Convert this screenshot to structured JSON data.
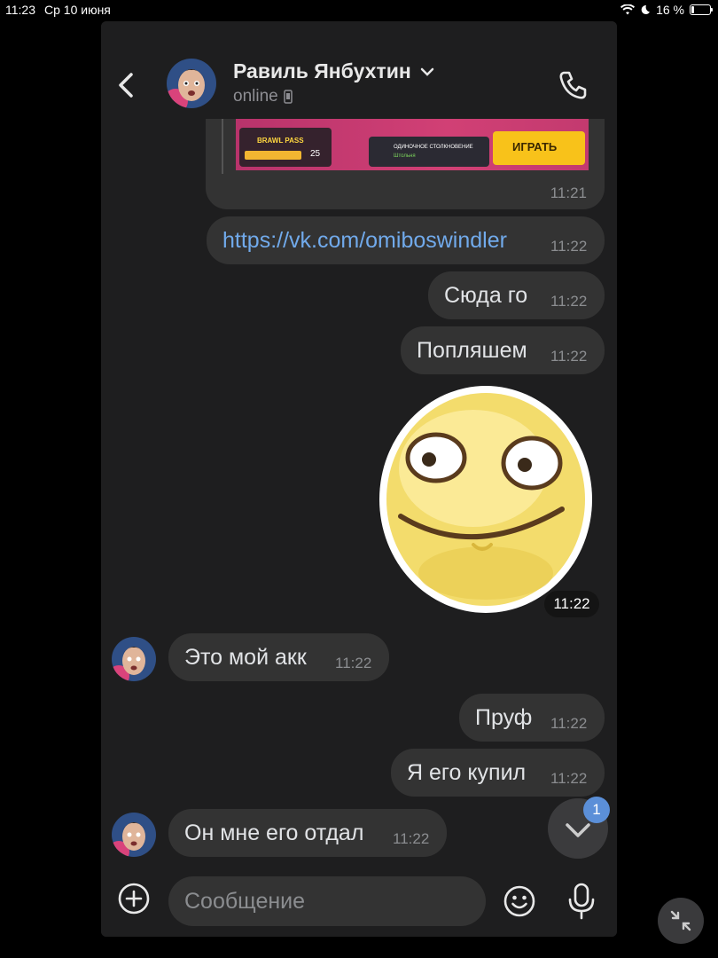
{
  "status_bar": {
    "time": "11:23",
    "date": "Ср 10 июня",
    "battery": "16 %",
    "battery_level": 0.16
  },
  "header": {
    "contact_name": "Равиль Янбухтин",
    "status": "online"
  },
  "game_preview": {
    "label": "BRAWL PASS",
    "progress": "454/500",
    "level": "25",
    "mode": "ОДИНОЧНОЕ СТОЛКНОВЕНИЕ",
    "mode_sub": "Штольня",
    "play": "ИГРАТЬ",
    "time": "11:21"
  },
  "messages": [
    {
      "id": "m1",
      "side": "out",
      "text": "https://vk.com/omiboswindler",
      "time": "11:22",
      "is_link": true
    },
    {
      "id": "m2",
      "side": "out",
      "text": "Сюда го",
      "time": "11:22"
    },
    {
      "id": "m3",
      "side": "out",
      "text": "Попляшем",
      "time": "11:22"
    },
    {
      "id": "m4",
      "side": "out",
      "type": "sticker",
      "time": "11:22"
    },
    {
      "id": "m5",
      "side": "in",
      "text": "Это мой акк",
      "time": "11:22"
    },
    {
      "id": "m6",
      "side": "out",
      "text": "Пруф",
      "time": "11:22"
    },
    {
      "id": "m7",
      "side": "out",
      "text": "Я его купил",
      "time": "11:22"
    },
    {
      "id": "m8",
      "side": "in",
      "text": "Он мне его отдал",
      "time": "11:22"
    }
  ],
  "scroll_badge": "1",
  "composer": {
    "placeholder": "Сообщение"
  },
  "colors": {
    "background": "#000000",
    "panel": "#1e1e1f",
    "bubble": "#333333",
    "link": "#71aaeb",
    "badge": "#5b8fd8"
  }
}
